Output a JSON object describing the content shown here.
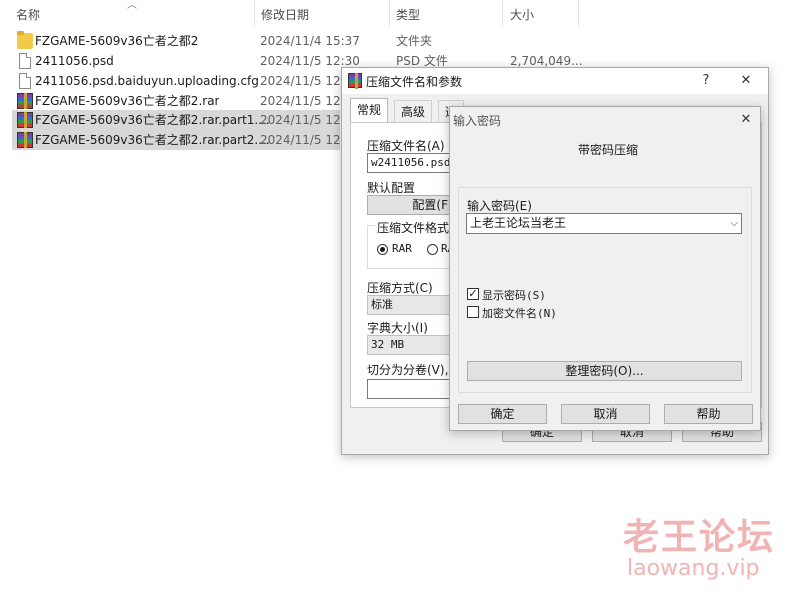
{
  "explorer": {
    "columns": {
      "name": "名称",
      "date": "修改日期",
      "type": "类型",
      "size": "大小"
    },
    "files": [
      {
        "icon": "folder-icon",
        "name": "FZGAME-5609v36亡者之都2",
        "date": "2024/11/4 15:37",
        "type": "文件夹",
        "size": ""
      },
      {
        "icon": "file-icon",
        "name": "2411056.psd",
        "date": "2024/11/5 12:30",
        "type": "PSD 文件",
        "size": "2,704,049..."
      },
      {
        "icon": "file-icon",
        "name": "2411056.psd.baiduyun.uploading.cfg",
        "date": "2024/11/5 12:3"
      },
      {
        "icon": "rar-icon",
        "name": "FZGAME-5609v36亡者之都2.rar",
        "date": "2024/11/5 12:0"
      },
      {
        "icon": "rar-icon",
        "name": "FZGAME-5609v36亡者之都2.rar.part1....",
        "date": "2024/11/5 12:2"
      },
      {
        "icon": "rar-icon",
        "name": "FZGAME-5609v36亡者之都2.rar.part2....",
        "date": "2024/11/5 12:2"
      }
    ]
  },
  "archive_dialog": {
    "title": "压缩文件名和参数",
    "help_glyph": "?",
    "close_glyph": "✕",
    "tabs": [
      "常规",
      "高级",
      "选"
    ],
    "archive_name_label": "压缩文件名(A)",
    "archive_name_value": "w2411056.psd",
    "default_profile_label": "默认配置",
    "profile_button": "配置(F",
    "format_group_label": "压缩文件格式",
    "format_rar": "RAR",
    "format_ra": "RA",
    "method_label": "压缩方式(C)",
    "method_value": "标准",
    "dict_label": "字典大小(I)",
    "dict_value": "32 MB",
    "split_label": "切分为分卷(V),",
    "ok_button": "确定",
    "cancel_button": "取消",
    "help_button": "帮助"
  },
  "password_dialog": {
    "title": "输入密码",
    "close_glyph": "✕",
    "heading": "带密码压缩",
    "password_label": "输入密码(E)",
    "password_value": "上老王论坛当老王",
    "dropdown_glyph": "⌵",
    "show_password_label": "显示密码(S)",
    "show_password_checked": true,
    "check_glyph": "✓",
    "encrypt_names_label": "加密文件名(N)",
    "encrypt_names_checked": false,
    "organize_button": "整理密码(O)...",
    "ok_button": "确定",
    "cancel_button": "取消",
    "help_button": "帮助"
  },
  "watermark": {
    "logo_text": "老王论坛",
    "url_text": "laowang.vip"
  }
}
